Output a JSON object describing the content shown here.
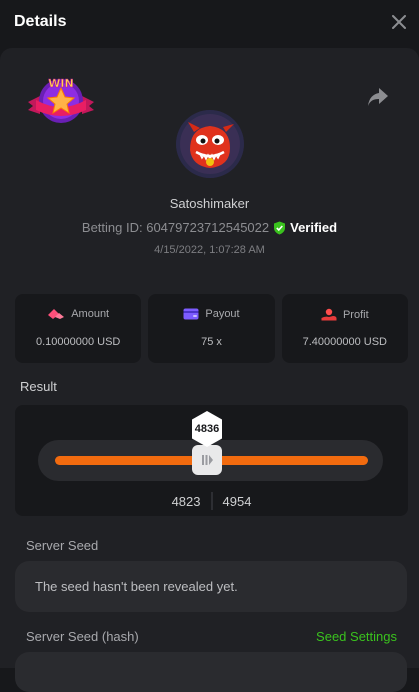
{
  "header": {
    "title": "Details",
    "close_icon": "close-icon"
  },
  "bet": {
    "username": "Satoshimaker",
    "betting_id_label": "Betting ID: 60479723712545022",
    "verified_label": "Verified",
    "date": "4/15/2022, 1:07:28 AM",
    "win_badge_text": "WIN"
  },
  "stats": {
    "amount": {
      "label": "Amount",
      "value": "0.10000000 USD",
      "icon": "coins-icon"
    },
    "payout": {
      "label": "Payout",
      "value": "75 x",
      "icon": "wallet-icon"
    },
    "profit": {
      "label": "Profit",
      "value": "7.40000000 USD",
      "icon": "profit-hand-icon"
    }
  },
  "result": {
    "label": "Result",
    "value": "4836",
    "range_low": "4823",
    "range_high": "4954"
  },
  "seeds": {
    "server_seed_label": "Server Seed",
    "server_seed_text": "The seed hasn't been revealed yet.",
    "server_seed_hash_label": "Server Seed (hash)",
    "seed_settings_label": "Seed Settings"
  },
  "colors": {
    "accent_orange": "#f26b0f",
    "verified_green": "#3ac21e",
    "background": "#17181b",
    "panel": "#202125"
  }
}
